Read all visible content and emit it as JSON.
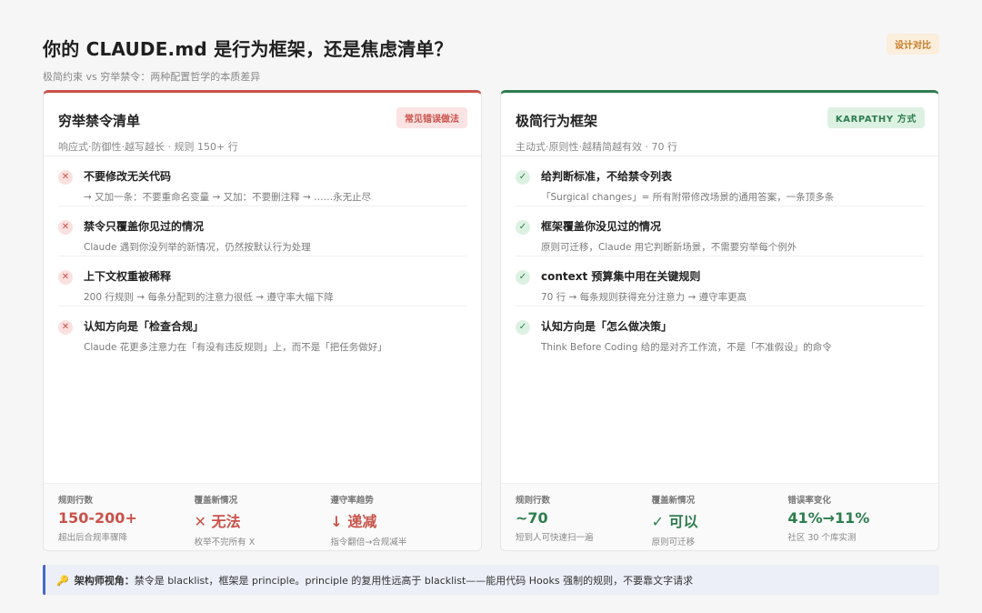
{
  "header": {
    "title": "你的 CLAUDE.md 是行为框架，还是焦虑清单？",
    "subtitle": "极简约束 vs 穷举禁令：两种配置哲学的本质差异",
    "badge": "设计对比"
  },
  "left": {
    "title": "穷举禁令清单",
    "badge": "常见错误做法",
    "meta": "响应式·防御性·越写越长 · 规则 150+ 行",
    "mark": "✕",
    "items": [
      {
        "title": "不要修改无关代码",
        "desc": "→ 又加一条：不要重命名变量 → 又加：不要删注释 → ……永无止尽"
      },
      {
        "title": "禁令只覆盖你见过的情况",
        "desc": "Claude 遇到你没列举的新情况，仍然按默认行为处理"
      },
      {
        "title": "上下文权重被稀释",
        "desc": "200 行规则 → 每条分配到的注意力很低 → 遵守率大幅下降"
      },
      {
        "title": "认知方向是「检查合规」",
        "desc": "Claude 花更多注意力在「有没有违反规则」上，而不是「把任务做好」"
      }
    ],
    "stats": [
      {
        "label": "规则行数",
        "value": "150-200+",
        "note": "超出后合规率骤降"
      },
      {
        "label": "覆盖新情况",
        "value": "✕ 无法",
        "note": "枚举不完所有 X"
      },
      {
        "label": "遵守率趋势",
        "value": "↓ 递减",
        "note": "指令翻倍→合规减半"
      }
    ]
  },
  "right": {
    "title": "极简行为框架",
    "badge": "KARPATHY 方式",
    "meta": "主动式·原则性·越精简越有效 · 70 行",
    "mark": "✓",
    "items": [
      {
        "title": "给判断标准，不给禁令列表",
        "desc": "「Surgical changes」= 所有附带修改场景的通用答案，一条顶多条"
      },
      {
        "title": "框架覆盖你没见过的情况",
        "desc": "原则可迁移，Claude 用它判断新场景，不需要穷举每个例外"
      },
      {
        "title": "context 预算集中用在关键规则",
        "desc": "70 行 → 每条规则获得充分注意力 → 遵守率更高"
      },
      {
        "title": "认知方向是「怎么做决策」",
        "desc": "Think Before Coding 给的是对齐工作流，不是「不准假设」的命令"
      }
    ],
    "stats": [
      {
        "label": "规则行数",
        "value": "~70",
        "note": "短到人可快速扫一遍"
      },
      {
        "label": "覆盖新情况",
        "value": "✓ 可以",
        "note": "原则可迁移"
      },
      {
        "label": "错误率变化",
        "value": "41%→11%",
        "note": "社区 30 个库实测"
      }
    ]
  },
  "note": {
    "icon": "🔑",
    "lead": "架构师视角：",
    "text": "禁令是 blacklist，框架是 principle。principle 的复用性远高于 blacklist——能用代码 Hooks 强制的规则，不要靠文字请求"
  },
  "colors": {
    "red": "#c9524a",
    "green": "#2e7d4f",
    "accent": "#4a67c9"
  }
}
